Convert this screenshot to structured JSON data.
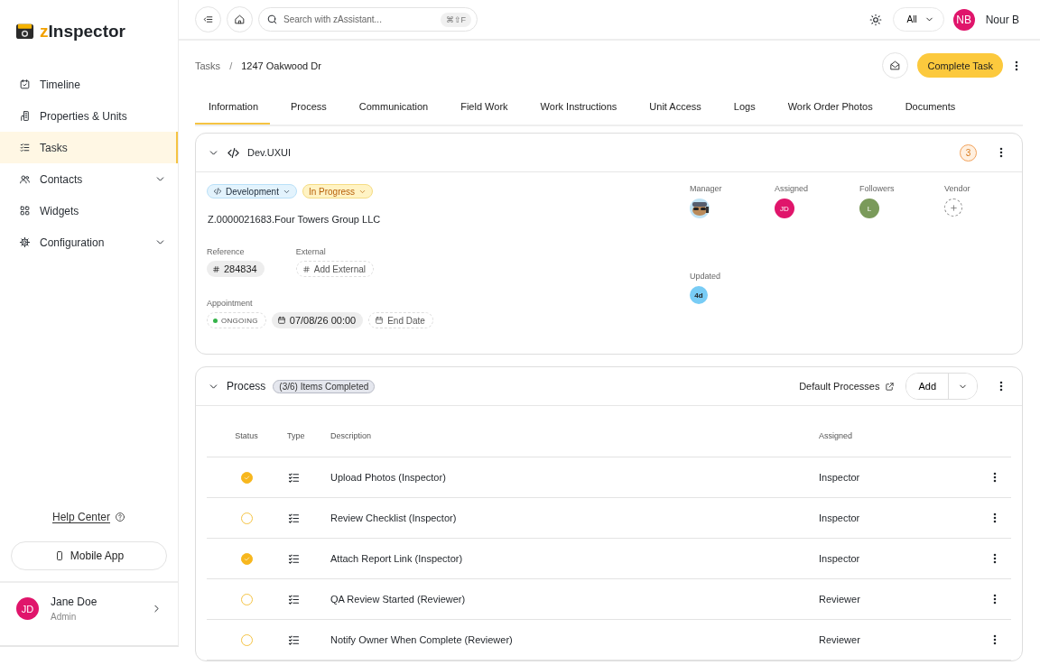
{
  "brand": {
    "accent": "z",
    "name": "Inspector"
  },
  "sidebar": {
    "items": [
      {
        "label": "Timeline",
        "selected": false,
        "expandable": false
      },
      {
        "label": "Properties & Units",
        "selected": false,
        "expandable": false
      },
      {
        "label": "Tasks",
        "selected": true,
        "expandable": false
      },
      {
        "label": "Contacts",
        "selected": false,
        "expandable": true
      },
      {
        "label": "Widgets",
        "selected": false,
        "expandable": false
      },
      {
        "label": "Configuration",
        "selected": false,
        "expandable": true
      }
    ],
    "help_link": "Help Center",
    "mobile_button": "Mobile App",
    "user": {
      "initials": "JD",
      "name": "Jane Doe",
      "role": "Admin",
      "color": "#e0156b"
    }
  },
  "topbar": {
    "search": {
      "placeholder": "Search with zAssistant...",
      "shortcut": "⌘⇧F"
    },
    "filter": "All",
    "user": {
      "initials": "NB",
      "name": "Nour B",
      "color": "#e0156b"
    }
  },
  "breadcrumb": {
    "items": [
      "Tasks",
      "1247 Oakwood Dr"
    ],
    "separator": "/"
  },
  "primary_action": "Complete Task",
  "tabs": [
    {
      "label": "Information",
      "selected": true
    },
    {
      "label": "Process",
      "selected": false
    },
    {
      "label": "Communication",
      "selected": false
    },
    {
      "label": "Field Work",
      "selected": false
    },
    {
      "label": "Work Instructions",
      "selected": false
    },
    {
      "label": "Unit Access",
      "selected": false
    },
    {
      "label": "Logs",
      "selected": false
    },
    {
      "label": "Work Order Photos",
      "selected": false
    },
    {
      "label": "Documents",
      "selected": false
    }
  ],
  "info_card": {
    "title": "Dev.UXUI",
    "expanded": true,
    "count": "3",
    "tags": [
      {
        "kind": "category",
        "label": "Development"
      },
      {
        "kind": "status",
        "label": "In Progress"
      }
    ],
    "company": "Z.0000021683.Four Towers Group LLC",
    "reference": {
      "label": "Reference",
      "value": "284834"
    },
    "external": {
      "label": "External",
      "value": "Add External"
    },
    "appointment": {
      "label": "Appointment",
      "status": "ONGOING",
      "start": "07/08/26 00:00",
      "end_placeholder": "End Date"
    },
    "people": [
      {
        "role": "Manager",
        "kind": "picture"
      },
      {
        "role": "Assigned",
        "kind": "initials",
        "initials": "JD",
        "color": "#e0156b"
      },
      {
        "role": "Followers",
        "kind": "initials",
        "initials": "L",
        "color": "#7a9a5a"
      },
      {
        "role": "Vendor",
        "kind": "add"
      }
    ],
    "updated": {
      "label": "Updated",
      "value": "4d"
    }
  },
  "process_card": {
    "title": "Process",
    "expanded": true,
    "progress": "(3/6) Items Completed",
    "link": "Default Processes",
    "add_button": "Add",
    "table": {
      "columns": [
        "Status",
        "Type",
        "Description",
        "Assigned"
      ],
      "rows": [
        {
          "checked": true,
          "description": "Upload Photos (Inspector)",
          "assigned": "Inspector"
        },
        {
          "checked": false,
          "description": "Review Checklist (Inspector)",
          "assigned": "Inspector"
        },
        {
          "checked": true,
          "description": "Attach Report Link (Inspector)",
          "assigned": "Inspector"
        },
        {
          "checked": false,
          "description": "QA Review Started (Reviewer)",
          "assigned": "Reviewer"
        },
        {
          "checked": false,
          "description": "Notify Owner When Complete (Reviewer)",
          "assigned": "Reviewer"
        }
      ]
    }
  }
}
